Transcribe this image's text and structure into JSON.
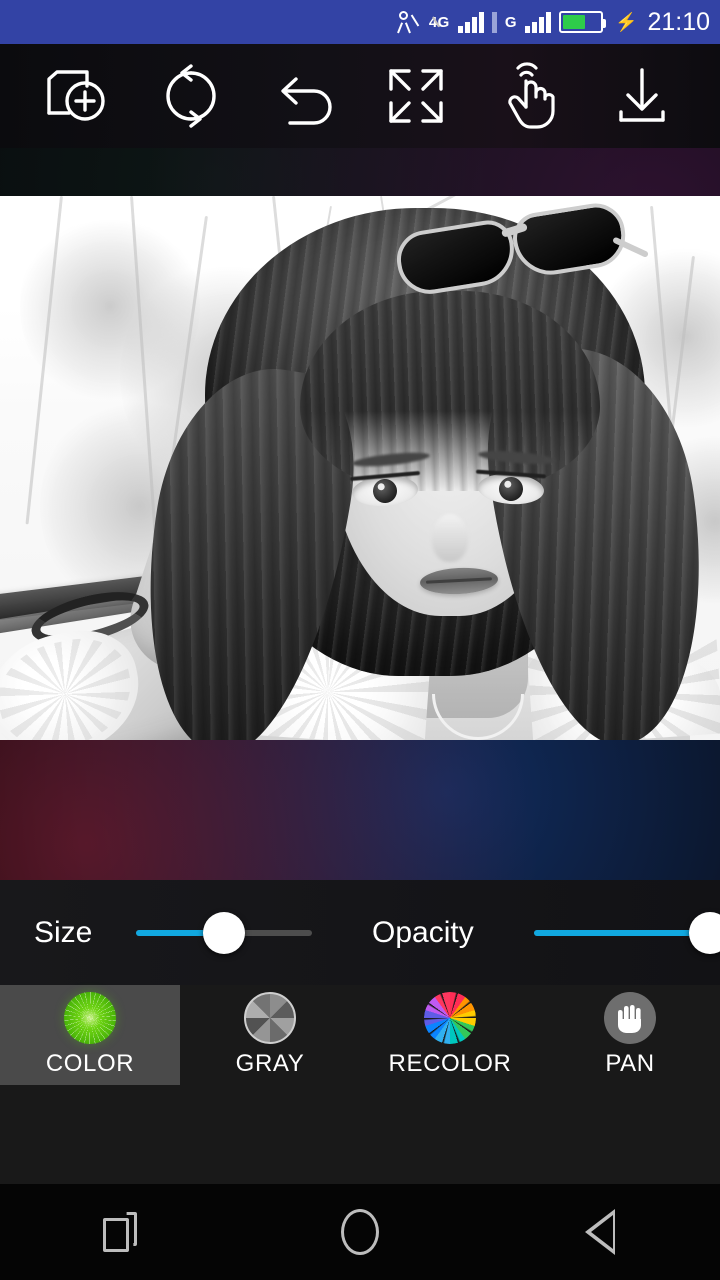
{
  "status_bar": {
    "network_type": "4G",
    "time": "21:10",
    "battery_level_percent": 62,
    "charging": true,
    "icons": {
      "person": "person-icon",
      "signal_sim1": "signal-bars-icon",
      "signal_sim2": "signal-bars-icon",
      "battery": "battery-icon",
      "charging_bolt": "bolt-icon"
    },
    "background_color": "#3343a5"
  },
  "toolbar": {
    "items": [
      {
        "name": "add-photo-icon",
        "label": "Add photo"
      },
      {
        "name": "reset-icon",
        "label": "Reset"
      },
      {
        "name": "undo-icon",
        "label": "Undo"
      },
      {
        "name": "fullscreen-icon",
        "label": "Fullscreen"
      },
      {
        "name": "touch-icon",
        "label": "Touch"
      },
      {
        "name": "download-icon",
        "label": "Save"
      }
    ]
  },
  "canvas": {
    "photo_alt": "Black and white selfie of a woman with sunglasses on her head",
    "filter": "grayscale"
  },
  "controls": {
    "size": {
      "label": "Size",
      "value": 50,
      "min": 0,
      "max": 100
    },
    "opacity": {
      "label": "Opacity",
      "value": 100,
      "min": 0,
      "max": 100
    },
    "accent_color": "#11a8e0",
    "selected_background": "#4a4a4a",
    "modes": [
      {
        "label": "COLOR",
        "icon": "color-wheel-icon",
        "selected": true
      },
      {
        "label": "GRAY",
        "icon": "gray-wheel-icon",
        "selected": false
      },
      {
        "label": "RECOLOR",
        "icon": "recolor-wheel-icon",
        "selected": false
      },
      {
        "label": "PAN",
        "icon": "pan-hand-icon",
        "selected": false
      }
    ]
  },
  "navbar": {
    "items": [
      {
        "name": "recents-button",
        "label": "Recents"
      },
      {
        "name": "home-button",
        "label": "Home"
      },
      {
        "name": "back-button",
        "label": "Back"
      }
    ]
  }
}
